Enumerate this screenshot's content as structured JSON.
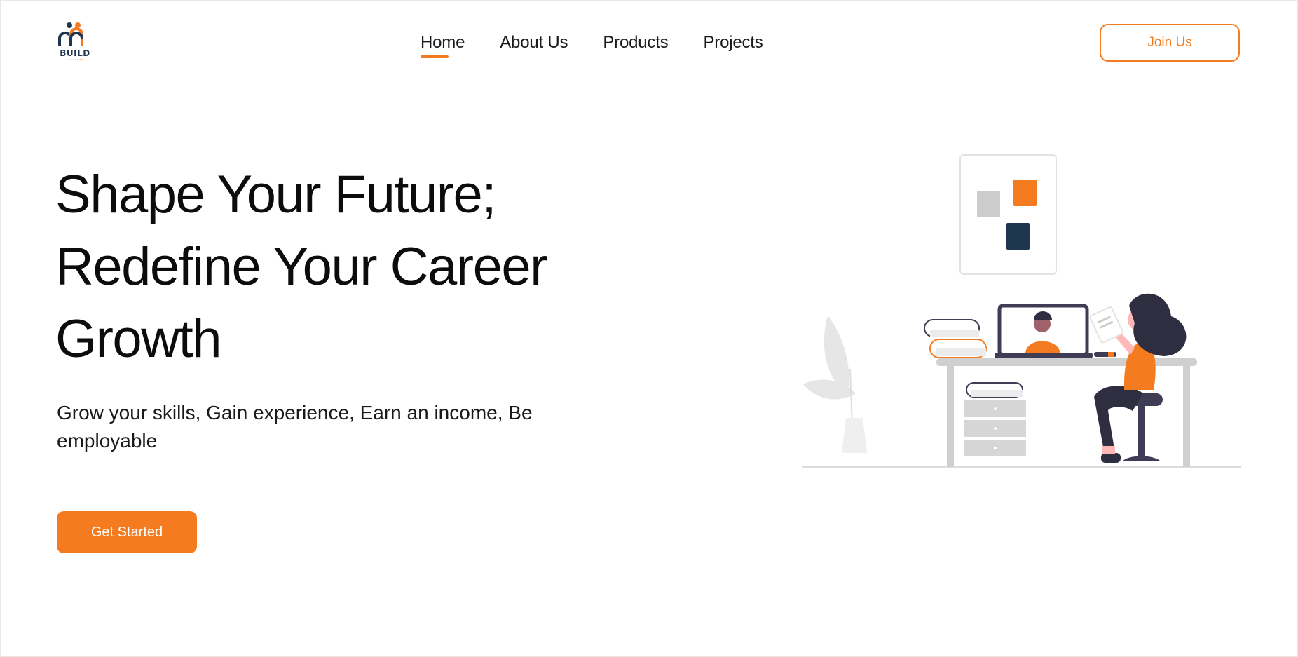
{
  "brand": {
    "logo_text": "BUILD",
    "logo_subtext": "TOGETHER",
    "primary_color": "#f47b20",
    "dark_color": "#1f3650"
  },
  "nav": {
    "items": [
      {
        "label": "Home",
        "active": true
      },
      {
        "label": "About Us",
        "active": false
      },
      {
        "label": "Products",
        "active": false
      },
      {
        "label": "Projects",
        "active": false
      }
    ]
  },
  "header": {
    "join_label": "Join Us"
  },
  "hero": {
    "title_lines": [
      "Shape Your Future;",
      "Redefine Your Career",
      "Growth"
    ],
    "subtitle": "Grow your skills, Gain experience, Earn an income, Be employable",
    "cta_label": "Get Started"
  },
  "illustration": {
    "icon": "person-working-at-desk-illustration"
  }
}
